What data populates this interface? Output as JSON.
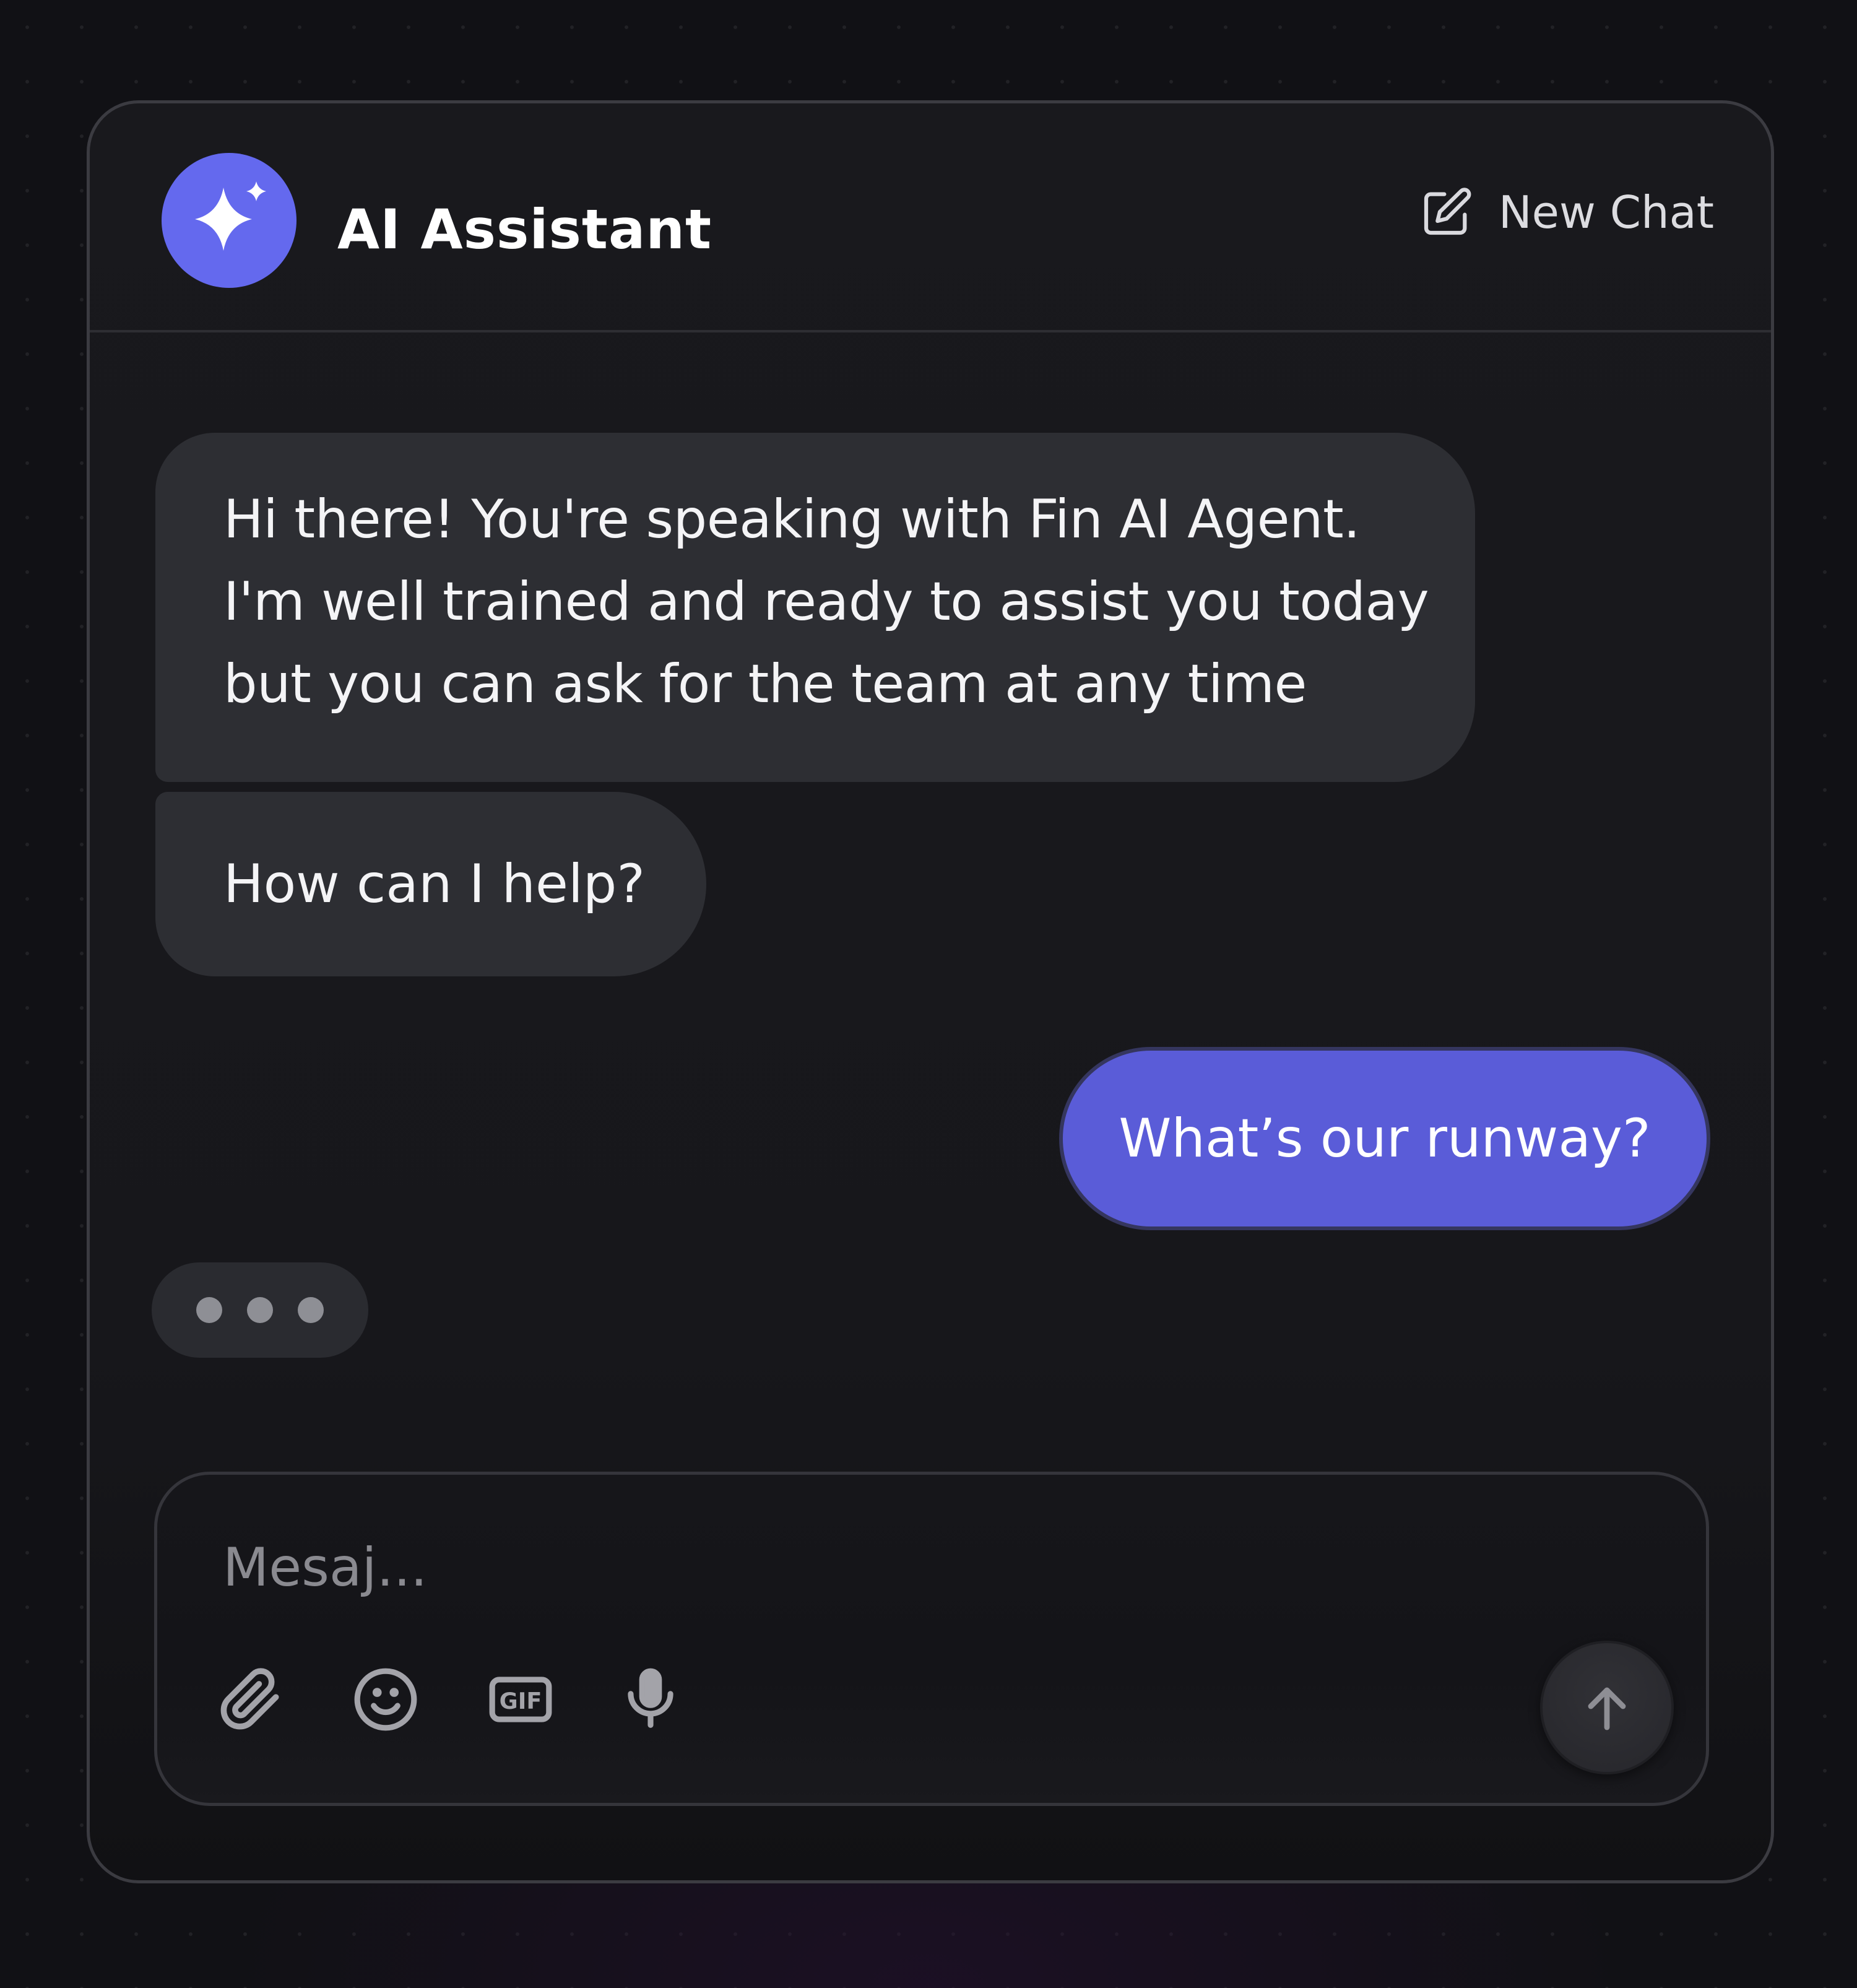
{
  "header": {
    "title": "AI Assistant",
    "new_chat_label": "New Chat",
    "avatar_icon": "sparkles-icon",
    "new_chat_icon": "edit-icon"
  },
  "messages": [
    {
      "role": "assistant",
      "text": "Hi there! You're speaking with Fin AI Agent.\nI'm well trained and ready to assist you today\nbut you can ask for the team at any time"
    },
    {
      "role": "assistant",
      "text": "How can I help?"
    },
    {
      "role": "user",
      "text": "What’s our runway?"
    }
  ],
  "typing_indicator": {
    "visible": true
  },
  "composer": {
    "placeholder": "Mesaj...",
    "value": "",
    "tools": [
      "paperclip-icon",
      "emoji-icon",
      "gif-icon",
      "microphone-icon"
    ],
    "gif_label": "GIF",
    "send_icon": "arrow-up-icon"
  },
  "colors": {
    "accent": "#6469ee",
    "user_bubble": "#5a5cd8",
    "assistant_bubble": "#2d2e33",
    "panel_bg": "#18181c",
    "page_bg": "#111115"
  }
}
